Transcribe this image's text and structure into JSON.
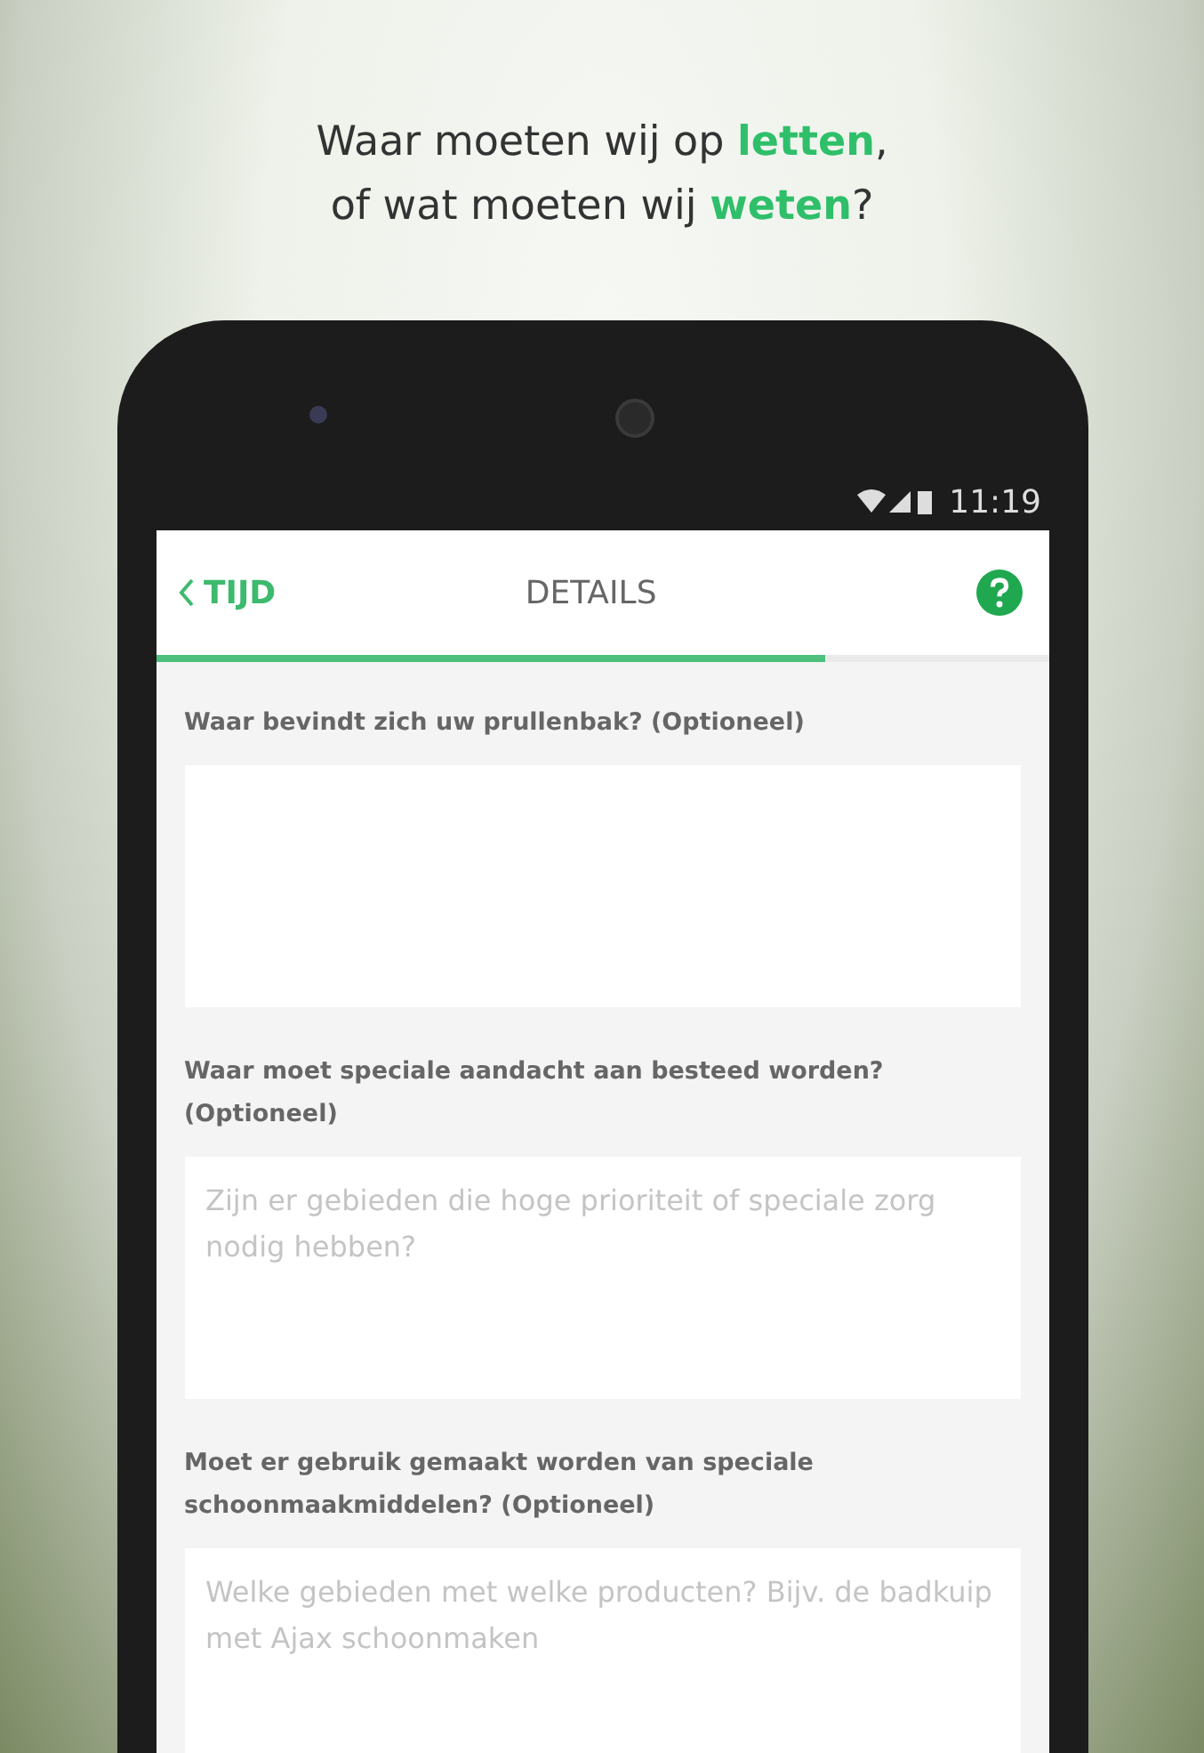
{
  "headline": [
    "Waar moeten wij op **letten**,",
    "of wat moeten wij **weten**?"
  ],
  "status_bar": {
    "time": "11:19"
  },
  "app_bar": {
    "back_label": "TIJD",
    "title": "DETAILS"
  },
  "progress": {
    "level": 0.75
  },
  "questions": [
    {
      "label": "Waar bevindt zich uw prullenbak? (Optioneel)"
    },
    {
      "label": "Waar moet speciale aandacht aan besteed worden? (Optioneel)",
      "placeholder": "Zijn er gebieden die hoge prioriteit of speciale zorg nodig hebben?"
    },
    {
      "label": "Moet er gebruik gemaakt worden van speciale schoonmaakmiddelen? (Optioneel)",
      "placeholder": "Welke gebieden met welke producten? Bijv. de badkuip met Ajax schoonmaken"
    }
  ]
}
